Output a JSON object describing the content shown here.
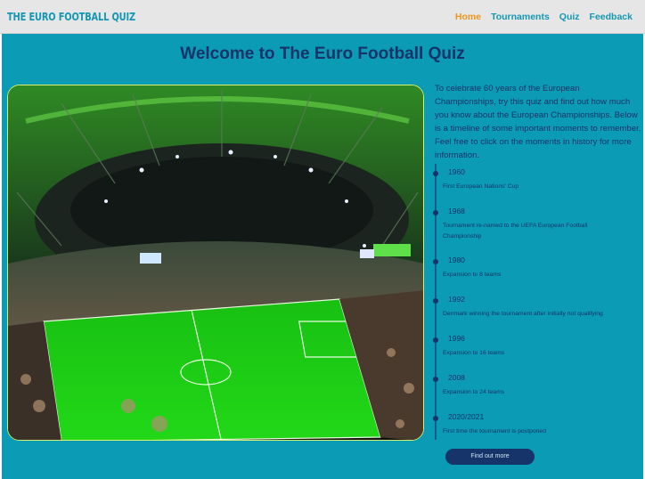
{
  "brand": "THE EURO FOOTBALL QUIZ",
  "nav": {
    "home": "Home",
    "tournaments": "Tournaments",
    "quiz": "Quiz",
    "feedback": "Feedback"
  },
  "page_title": "Welcome to The Euro Football Quiz",
  "intro": "To celebrate 60 years of the European Championships, try this quiz and find out how much you know about the European Championships. Below is a timeline of some important moments to remember. Feel free to click on the moments in history for more information.",
  "timeline": [
    {
      "year": "1960",
      "desc": "First European Nations' Cup"
    },
    {
      "year": "1968",
      "desc": "Tournament re-named to the UEFA European Football Championship"
    },
    {
      "year": "1980",
      "desc": "Expansion to 8 teams"
    },
    {
      "year": "1992",
      "desc": "Denmark winning the tournament after initially not qualifying"
    },
    {
      "year": "1996",
      "desc": "Expansion to 16 teams"
    },
    {
      "year": "2008",
      "desc": "Expansion to 24 teams"
    },
    {
      "year": "2020/2021",
      "desc": "First time the tournament is postponed"
    }
  ],
  "find_out_more": "Find out more",
  "colors": {
    "background": "#0b9bb4",
    "navbar": "#e6e6e6",
    "brand": "#1497b3",
    "nav_active": "#f0961e",
    "heading": "#16336a",
    "hero_border": "#d8f06a",
    "pitch": "#1fd014"
  }
}
